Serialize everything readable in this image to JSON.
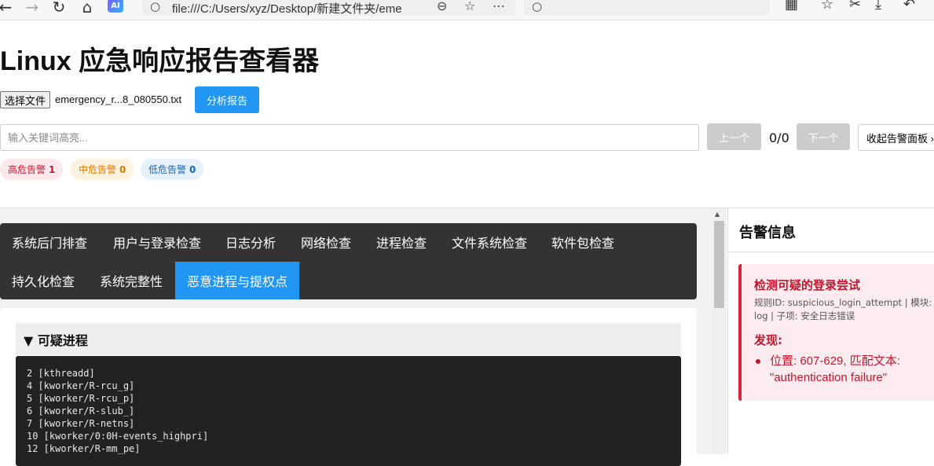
{
  "browser": {
    "address": "file:///C:/Users/xyz/Desktop/新建文件夹/eme",
    "search_placeholder": ""
  },
  "page": {
    "title": "Linux 应急响应报告查看器"
  },
  "upload": {
    "choose_file_label": "选择文件",
    "file_name": "emergency_r...8_080550.txt",
    "analyze_label": "分析报告"
  },
  "search": {
    "placeholder": "输入关键词高亮...",
    "prev_label": "上一个",
    "count": "0/0",
    "next_label": "下一个",
    "collapse_label": "收起告警面板 ›"
  },
  "alert_counts": {
    "high_label": "高危告警",
    "high_count": "1",
    "mid_label": "中危告警",
    "mid_count": "0",
    "low_label": "低危告警",
    "low_count": "0"
  },
  "tabs": [
    {
      "label": "系统后门排查"
    },
    {
      "label": "用户与登录检查"
    },
    {
      "label": "日志分析"
    },
    {
      "label": "网络检查"
    },
    {
      "label": "进程检查"
    },
    {
      "label": "文件系统检查"
    },
    {
      "label": "软件包检查"
    },
    {
      "label": "持久化检查"
    },
    {
      "label": "系统完整性"
    },
    {
      "label": "恶意进程与提权点",
      "active": true
    }
  ],
  "section": {
    "title": "▼ 可疑进程",
    "lines": [
      "2 [kthreadd]",
      "4 [kworker/R-rcu_g]",
      "5 [kworker/R-rcu_p]",
      "6 [kworker/R-slub_]",
      "7 [kworker/R-netns]",
      "10 [kworker/0:0H-events_highpri]",
      "12 [kworker/R-mm_pe]"
    ]
  },
  "alerts_panel": {
    "title": "告警信息",
    "alert": {
      "name": "检测可疑的登录尝试",
      "meta": "规则ID: suspicious_login_attempt | 模块: log | 子项: 安全日志错误",
      "finding_label": "发现:",
      "findings": [
        "位置: 607-629, 匹配文本: \"authentication failure\""
      ]
    }
  },
  "colors": {
    "accent": "#2196f3",
    "tab_bar": "#333333",
    "danger": "#c0172f"
  }
}
